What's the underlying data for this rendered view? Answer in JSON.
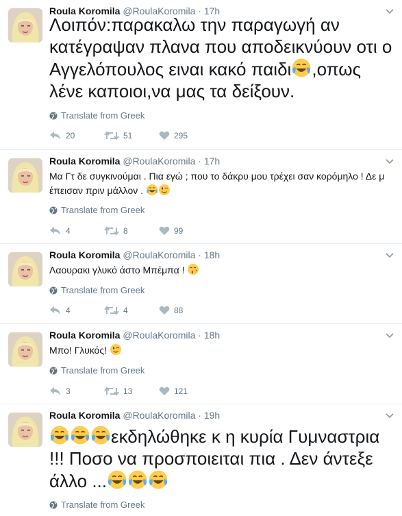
{
  "author": {
    "name": "Roula Koromila",
    "handle": "@RoulaKoromila"
  },
  "translate_label": "Translate from Greek",
  "colors": {
    "text": "#14171a",
    "secondary": "#657786",
    "divider": "#e6ecf0",
    "emoji_face": "#ffcc4d",
    "tear": "#5dadec"
  },
  "tweets": [
    {
      "time": "17h",
      "text_parts": [
        "Λοιπόν:παρακαλω την παραγωγή αν κατέγραψαν πλανα που αποδεικνύουν οτι ο Αγγελόπουλος ειναι κακό παιδι",
        ",οπως λένε καποιοι,να μας τα δείξουν."
      ],
      "emojis": [
        "face-with-tears-of-joy"
      ],
      "replies": "20",
      "retweets": "51",
      "likes": "295"
    },
    {
      "time": "17h",
      "text_parts": [
        "Μα Γτ δε συγκινούμαι . Πια εγώ ; που το δάκρυ μου τρέχει σαν κορόμηλο ! Δε μ έπεισαν πριν μάλλον . "
      ],
      "emojis": [
        "face-with-tears-of-joy",
        "winking-face"
      ],
      "replies": "4",
      "retweets": "8",
      "likes": "99"
    },
    {
      "time": "18h",
      "text_parts": [
        "Λαουρακι γλυκό άστο Μπέμπα ! "
      ],
      "emojis": [
        "face-blowing-a-kiss"
      ],
      "replies": "4",
      "retweets": "4",
      "likes": "88"
    },
    {
      "time": "18h",
      "text_parts": [
        "Μπο! Γλυκός! "
      ],
      "emojis": [
        "winking-face"
      ],
      "replies": "3",
      "retweets": "13",
      "likes": "121"
    },
    {
      "time": "19h",
      "text_parts": [
        "",
        "εκδηλώθηκε κ η κυρία Γυμναστρια !!! Ποσο να προσποιειται πια . Δεν άντεξε άλλο ..."
      ],
      "emojis": [
        "face-with-tears-of-joy",
        "face-with-tears-of-joy",
        "face-with-tears-of-joy"
      ],
      "replies": "",
      "retweets": "",
      "likes": ""
    }
  ]
}
